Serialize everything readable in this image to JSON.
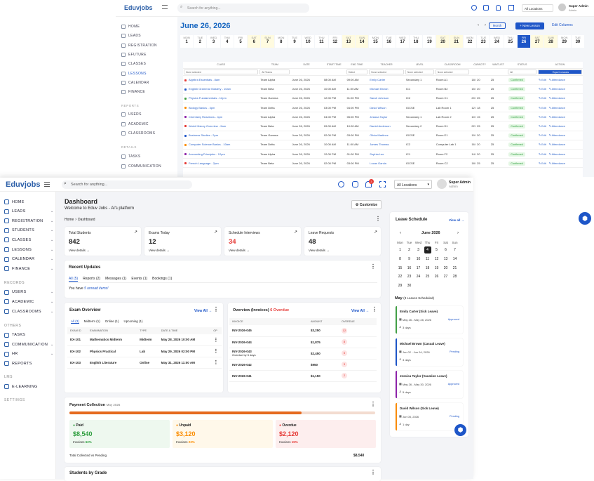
{
  "back": {
    "brand": "Eduvjobs",
    "search_placeholder": "Search for anything...",
    "location": "All Locations",
    "user": {
      "name": "Super Admin",
      "role": "Admin"
    },
    "sidebar": {
      "items": [
        {
          "label": "HOME"
        },
        {
          "label": "LEADS"
        },
        {
          "label": "REGISTRATION"
        },
        {
          "label": "EFUTURE"
        },
        {
          "label": "CLASSES"
        },
        {
          "label": "LESSONS"
        },
        {
          "label": "CALENDAR"
        },
        {
          "label": "FINANCE"
        }
      ],
      "sec_reports": "REPORTS",
      "report_items": [
        {
          "label": "USERS"
        },
        {
          "label": "ACADEMIC"
        },
        {
          "label": "CLASSROOMS"
        }
      ],
      "sec_others": "DETAILS",
      "other_items": [
        {
          "label": "TASKS"
        },
        {
          "label": "COMMUNICATION"
        }
      ]
    },
    "title": "June 26, 2026",
    "month_btn": "Month",
    "new_lesson": "+ New Lesson",
    "edit_columns": "Edit Columns",
    "days": [
      {
        "w": "MON",
        "d": "1"
      },
      {
        "w": "TUE",
        "d": "2"
      },
      {
        "w": "WED",
        "d": "3"
      },
      {
        "w": "THU",
        "d": "4"
      },
      {
        "w": "FRI",
        "d": "5"
      },
      {
        "w": "SAT",
        "d": "6"
      },
      {
        "w": "SUN",
        "d": "7"
      },
      {
        "w": "MON",
        "d": "8"
      },
      {
        "w": "TUE",
        "d": "9"
      },
      {
        "w": "WED",
        "d": "10"
      },
      {
        "w": "THU",
        "d": "11"
      },
      {
        "w": "FRI",
        "d": "12"
      },
      {
        "w": "SAT",
        "d": "13"
      },
      {
        "w": "SUN",
        "d": "14"
      },
      {
        "w": "MON",
        "d": "15"
      },
      {
        "w": "TUE",
        "d": "16"
      },
      {
        "w": "WED",
        "d": "17"
      },
      {
        "w": "THU",
        "d": "18"
      },
      {
        "w": "FRI",
        "d": "19"
      },
      {
        "w": "SAT",
        "d": "20"
      },
      {
        "w": "SUN",
        "d": "21"
      },
      {
        "w": "MON",
        "d": "22"
      },
      {
        "w": "TUE",
        "d": "23"
      },
      {
        "w": "WED",
        "d": "24"
      },
      {
        "w": "THU",
        "d": "25"
      },
      {
        "w": "FRI",
        "d": "26"
      },
      {
        "w": "SAT",
        "d": "27"
      },
      {
        "w": "SUN",
        "d": "28"
      },
      {
        "w": "MON",
        "d": "29"
      },
      {
        "w": "TUE",
        "d": "30"
      }
    ],
    "table": {
      "headers": [
        "CLASS",
        "TEAM",
        "DATE",
        "START TIME",
        "END TIME",
        "TEACHER",
        "LEVEL",
        "CLASSROOM",
        "CAPACITY",
        "WAITLIST",
        "STATUS",
        "ACTION"
      ],
      "filters": [
        "None selected",
        "All Teams",
        "",
        "",
        "Select",
        "None selected",
        "None selected",
        "None selected",
        "",
        "",
        "All",
        "Export Lessons"
      ],
      "rows": [
        {
          "cls": "Algebra Essentials - 8am",
          "color": "#e53935",
          "team": "Team Alpha",
          "date": "June 26, 2026",
          "start": "08:00 AM",
          "end": "09:00 AM",
          "teacher": "Emily Carter",
          "level": "Secondary 1",
          "room": "Room A1",
          "cap": "18 / 20",
          "wait": "25",
          "status": "Confirmed"
        },
        {
          "cls": "English Grammar Mastery - 10am",
          "color": "#1e56c8",
          "team": "Team Beta",
          "date": "June 26, 2026",
          "start": "10:00 AM",
          "end": "11:00 AM",
          "teacher": "Michael Brown",
          "level": "IC1",
          "room": "Room B2",
          "cap": "15 / 20",
          "wait": "25",
          "status": "Confirmed"
        },
        {
          "cls": "Physics Fundamentals - 12pm",
          "color": "#43a047",
          "team": "Team Gamma",
          "date": "June 26, 2026",
          "start": "12:00 PM",
          "end": "01:00 PM",
          "teacher": "Sarah Johnson",
          "level": "IC2",
          "room": "Room C1",
          "cap": "20 / 25",
          "wait": "25",
          "status": "Confirmed"
        },
        {
          "cls": "Biology Basics - 3pm",
          "color": "#fb8c00",
          "team": "Team Delta",
          "date": "June 26, 2026",
          "start": "03:00 PM",
          "end": "04:00 PM",
          "teacher": "David Wilson",
          "level": "IGCSE",
          "room": "Lab Room 1",
          "cap": "12 / 18",
          "wait": "25",
          "status": "Confirmed"
        },
        {
          "cls": "Chemistry Reactions - 4pm",
          "color": "#8e24aa",
          "team": "Team Alpha",
          "date": "June 26, 2026",
          "start": "04:00 PM",
          "end": "05:00 PM",
          "teacher": "Jessica Taylor",
          "level": "Secondary 1",
          "room": "Lab Room 2",
          "cap": "10 / 15",
          "wait": "25",
          "status": "Confirmed"
        },
        {
          "cls": "World History Overview - 9am",
          "color": "#e53935",
          "team": "Team Beta",
          "date": "June 26, 2026",
          "start": "09:00 AM",
          "end": "10:00 AM",
          "teacher": "Daniel Anderson",
          "level": "Secondary 2",
          "room": "Room D1",
          "cap": "22 / 25",
          "wait": "25",
          "status": "Confirmed"
        },
        {
          "cls": "Business Studies - 2pm",
          "color": "#1e56c8",
          "team": "Team Gamma",
          "date": "June 26, 2026",
          "start": "02:00 PM",
          "end": "03:00 PM",
          "teacher": "Olivia Martinez",
          "level": "IGCSE",
          "room": "Room E1",
          "cap": "19 / 20",
          "wait": "25",
          "status": "Confirmed"
        },
        {
          "cls": "Computer Science Basics - 10am",
          "color": "#fb8c00",
          "team": "Team Delta",
          "date": "June 26, 2026",
          "start": "10:00 AM",
          "end": "11:00 AM",
          "teacher": "James Thomas",
          "level": "IC2",
          "room": "Computer Lab 1",
          "cap": "16 / 20",
          "wait": "25",
          "status": "Confirmed"
        },
        {
          "cls": "Accounting Principles - 12pm",
          "color": "#8e24aa",
          "team": "Team Alpha",
          "date": "June 26, 2026",
          "start": "12:00 PM",
          "end": "01:00 PM",
          "teacher": "Sophia Lee",
          "level": "IC1",
          "room": "Room F2",
          "cap": "14 / 20",
          "wait": "25",
          "status": "Confirmed"
        },
        {
          "cls": "French Language - 2pm",
          "color": "#e53935",
          "team": "Team Beta",
          "date": "June 26, 2026",
          "start": "02:00 PM",
          "end": "03:00 PM",
          "teacher": "Lucas Garcia",
          "level": "IGCSE",
          "room": "Room C2",
          "cap": "18 / 25",
          "wait": "25",
          "status": "Confirmed"
        }
      ],
      "edit": "Edit",
      "attendance": "Attendance"
    }
  },
  "front": {
    "brand": "Eduvjobs",
    "search_placeholder": "Search for anything...",
    "location": "All Locations",
    "user": {
      "name": "Super Admin",
      "role": "Admin"
    },
    "notif_count": "3",
    "sidebar": {
      "items": [
        {
          "label": "HOME"
        },
        {
          "label": "LEADS"
        },
        {
          "label": "REGISTRATION"
        },
        {
          "label": "STUDENTS"
        },
        {
          "label": "CLASSES"
        },
        {
          "label": "LESSONS"
        },
        {
          "label": "CALENDAR"
        },
        {
          "label": "FINANCE"
        }
      ],
      "sec_records": "RECORDS",
      "records_items": [
        {
          "label": "USERS"
        },
        {
          "label": "ACADEMIC"
        },
        {
          "label": "CLASSROOMS"
        }
      ],
      "sec_others": "OTHERS",
      "others_items": [
        {
          "label": "TASKS"
        },
        {
          "label": "COMMUNICATION"
        },
        {
          "label": "HR"
        },
        {
          "label": "REPORTS"
        }
      ],
      "sec_lms": "LMS",
      "lms_items": [
        {
          "label": "E-LEARNING"
        }
      ],
      "sec_settings": "SETTINGS"
    },
    "title": "Dashboard",
    "welcome": "Welcome to Eduv Jobs - Al's platform",
    "customize": "Customize",
    "breadcrumb": {
      "home": "Home",
      "sep": ">",
      "current": "Dashboard"
    },
    "stats": [
      {
        "label": "Total Students",
        "value": "842",
        "link": "View details"
      },
      {
        "label": "Exams Today",
        "value": "12",
        "link": "View details"
      },
      {
        "label": "Schedule Interviews",
        "value": "34",
        "link": "View details"
      },
      {
        "label": "Leave Requests",
        "value": "48",
        "link": "View details"
      }
    ],
    "recent": {
      "title": "Recent Updates",
      "tabs": [
        "All (5)",
        "Reports (2)",
        "Messages (1)",
        "Events (1)",
        "Bookings (1)"
      ],
      "message_prefix": "You have ",
      "message_link": "5 unread items!"
    },
    "exam": {
      "title": "Exam Overview",
      "view_all": "View All",
      "tabs": [
        "All (3)",
        "Midterm (1)",
        "Online (1)",
        "Upcoming (1)"
      ],
      "headers": [
        "EXAM ID",
        "EXAMINATION",
        "TYPE",
        "DATE & TIME",
        "OP"
      ],
      "rows": [
        {
          "id": "EX-101",
          "name": "Mathematics Midterm",
          "type": "Midterm",
          "date": "May 28, 2026 10:00 AM"
        },
        {
          "id": "EX-102",
          "name": "Physics Practical",
          "type": "Lab",
          "date": "May 29, 2026 02:00 PM"
        },
        {
          "id": "EX-103",
          "name": "English Literature",
          "type": "Online",
          "date": "May 31, 2026 11:00 AM"
        }
      ]
    },
    "invoices": {
      "title": "Overview (Invoices)",
      "overdue_label": "6 Overdue",
      "view_all": "View All",
      "headers": [
        "INVOICE",
        "AMOUNT",
        "OVERDUE"
      ],
      "rows": [
        {
          "id": "INV-2026-045",
          "sub": "",
          "amount": "$3,250",
          "overdue": "12"
        },
        {
          "id": "INV-2026-044",
          "sub": "",
          "amount": "$1,875",
          "overdue": "8"
        },
        {
          "id": "INV-2026-043",
          "sub": "Overdue by 5 days",
          "amount": "$2,450",
          "overdue": "5"
        },
        {
          "id": "INV-2026-042",
          "sub": "",
          "amount": "$950",
          "overdue": "3"
        },
        {
          "id": "INV-2026-041",
          "sub": "",
          "amount": "$1,150",
          "overdue": "2"
        }
      ]
    },
    "payment": {
      "title": "Payment Collection",
      "period": "May 2026",
      "progress_paid_pct": 76,
      "paid": {
        "label": "Paid",
        "amount": "$8,540",
        "invoices": "Invoices",
        "pct": "62%"
      },
      "unpaid": {
        "label": "Unpaid",
        "amount": "$3,120",
        "invoices": "Invoices",
        "pct": "23%"
      },
      "overdue": {
        "label": "Overdue",
        "amount": "$2,120",
        "invoices": "Invoices",
        "pct": "15%"
      },
      "total_label": "Total Collected vs Pending",
      "total_value": "$8,540"
    },
    "grade": {
      "title": "Students by Grade"
    },
    "leave": {
      "title": "Leave Schedule",
      "view_all": "View all",
      "month": "June 2026",
      "weekdays": [
        "Mon",
        "Tue",
        "Wed",
        "Thu",
        "Fri",
        "Sat",
        "Sun"
      ],
      "weeks": [
        [
          "1",
          "2",
          "3",
          "4",
          "5",
          "6",
          "7"
        ],
        [
          "8",
          "9",
          "10",
          "11",
          "12",
          "13",
          "14"
        ],
        [
          "15",
          "16",
          "17",
          "18",
          "19",
          "20",
          "21"
        ],
        [
          "22",
          "23",
          "24",
          "25",
          "26",
          "27",
          "28"
        ],
        [
          "29",
          "30",
          "",
          "",
          "",
          "",
          ""
        ]
      ],
      "selected_day": "4",
      "section": "May",
      "section_sub": "(3 Leaves Scheduled)",
      "entries": [
        {
          "name": "Emily Carter (Sick Leave)",
          "dates": "May 26 - May 28, 2026",
          "days": "3 days",
          "status": "Approved",
          "color": "#43a047",
          "status_color": "#1e56c8"
        },
        {
          "name": "Michael Brown (Casual Leave)",
          "dates": "Jun 02 - Jun 04, 2026",
          "days": "3 days",
          "status": "Pending",
          "color": "#1e56c8",
          "status_color": "#1e56c8"
        },
        {
          "name": "Jessica Taylor (Vacation Leave)",
          "dates": "May 26 - May 30, 2026",
          "days": "5 days",
          "status": "Approved",
          "color": "#8e24aa",
          "status_color": "#1e56c8"
        },
        {
          "name": "David Wilson (Sick Leave)",
          "dates": "Jun 05, 2026",
          "days": "1 day",
          "status": "Pending",
          "color": "#fb8c00",
          "status_color": "#1e56c8"
        }
      ]
    }
  }
}
